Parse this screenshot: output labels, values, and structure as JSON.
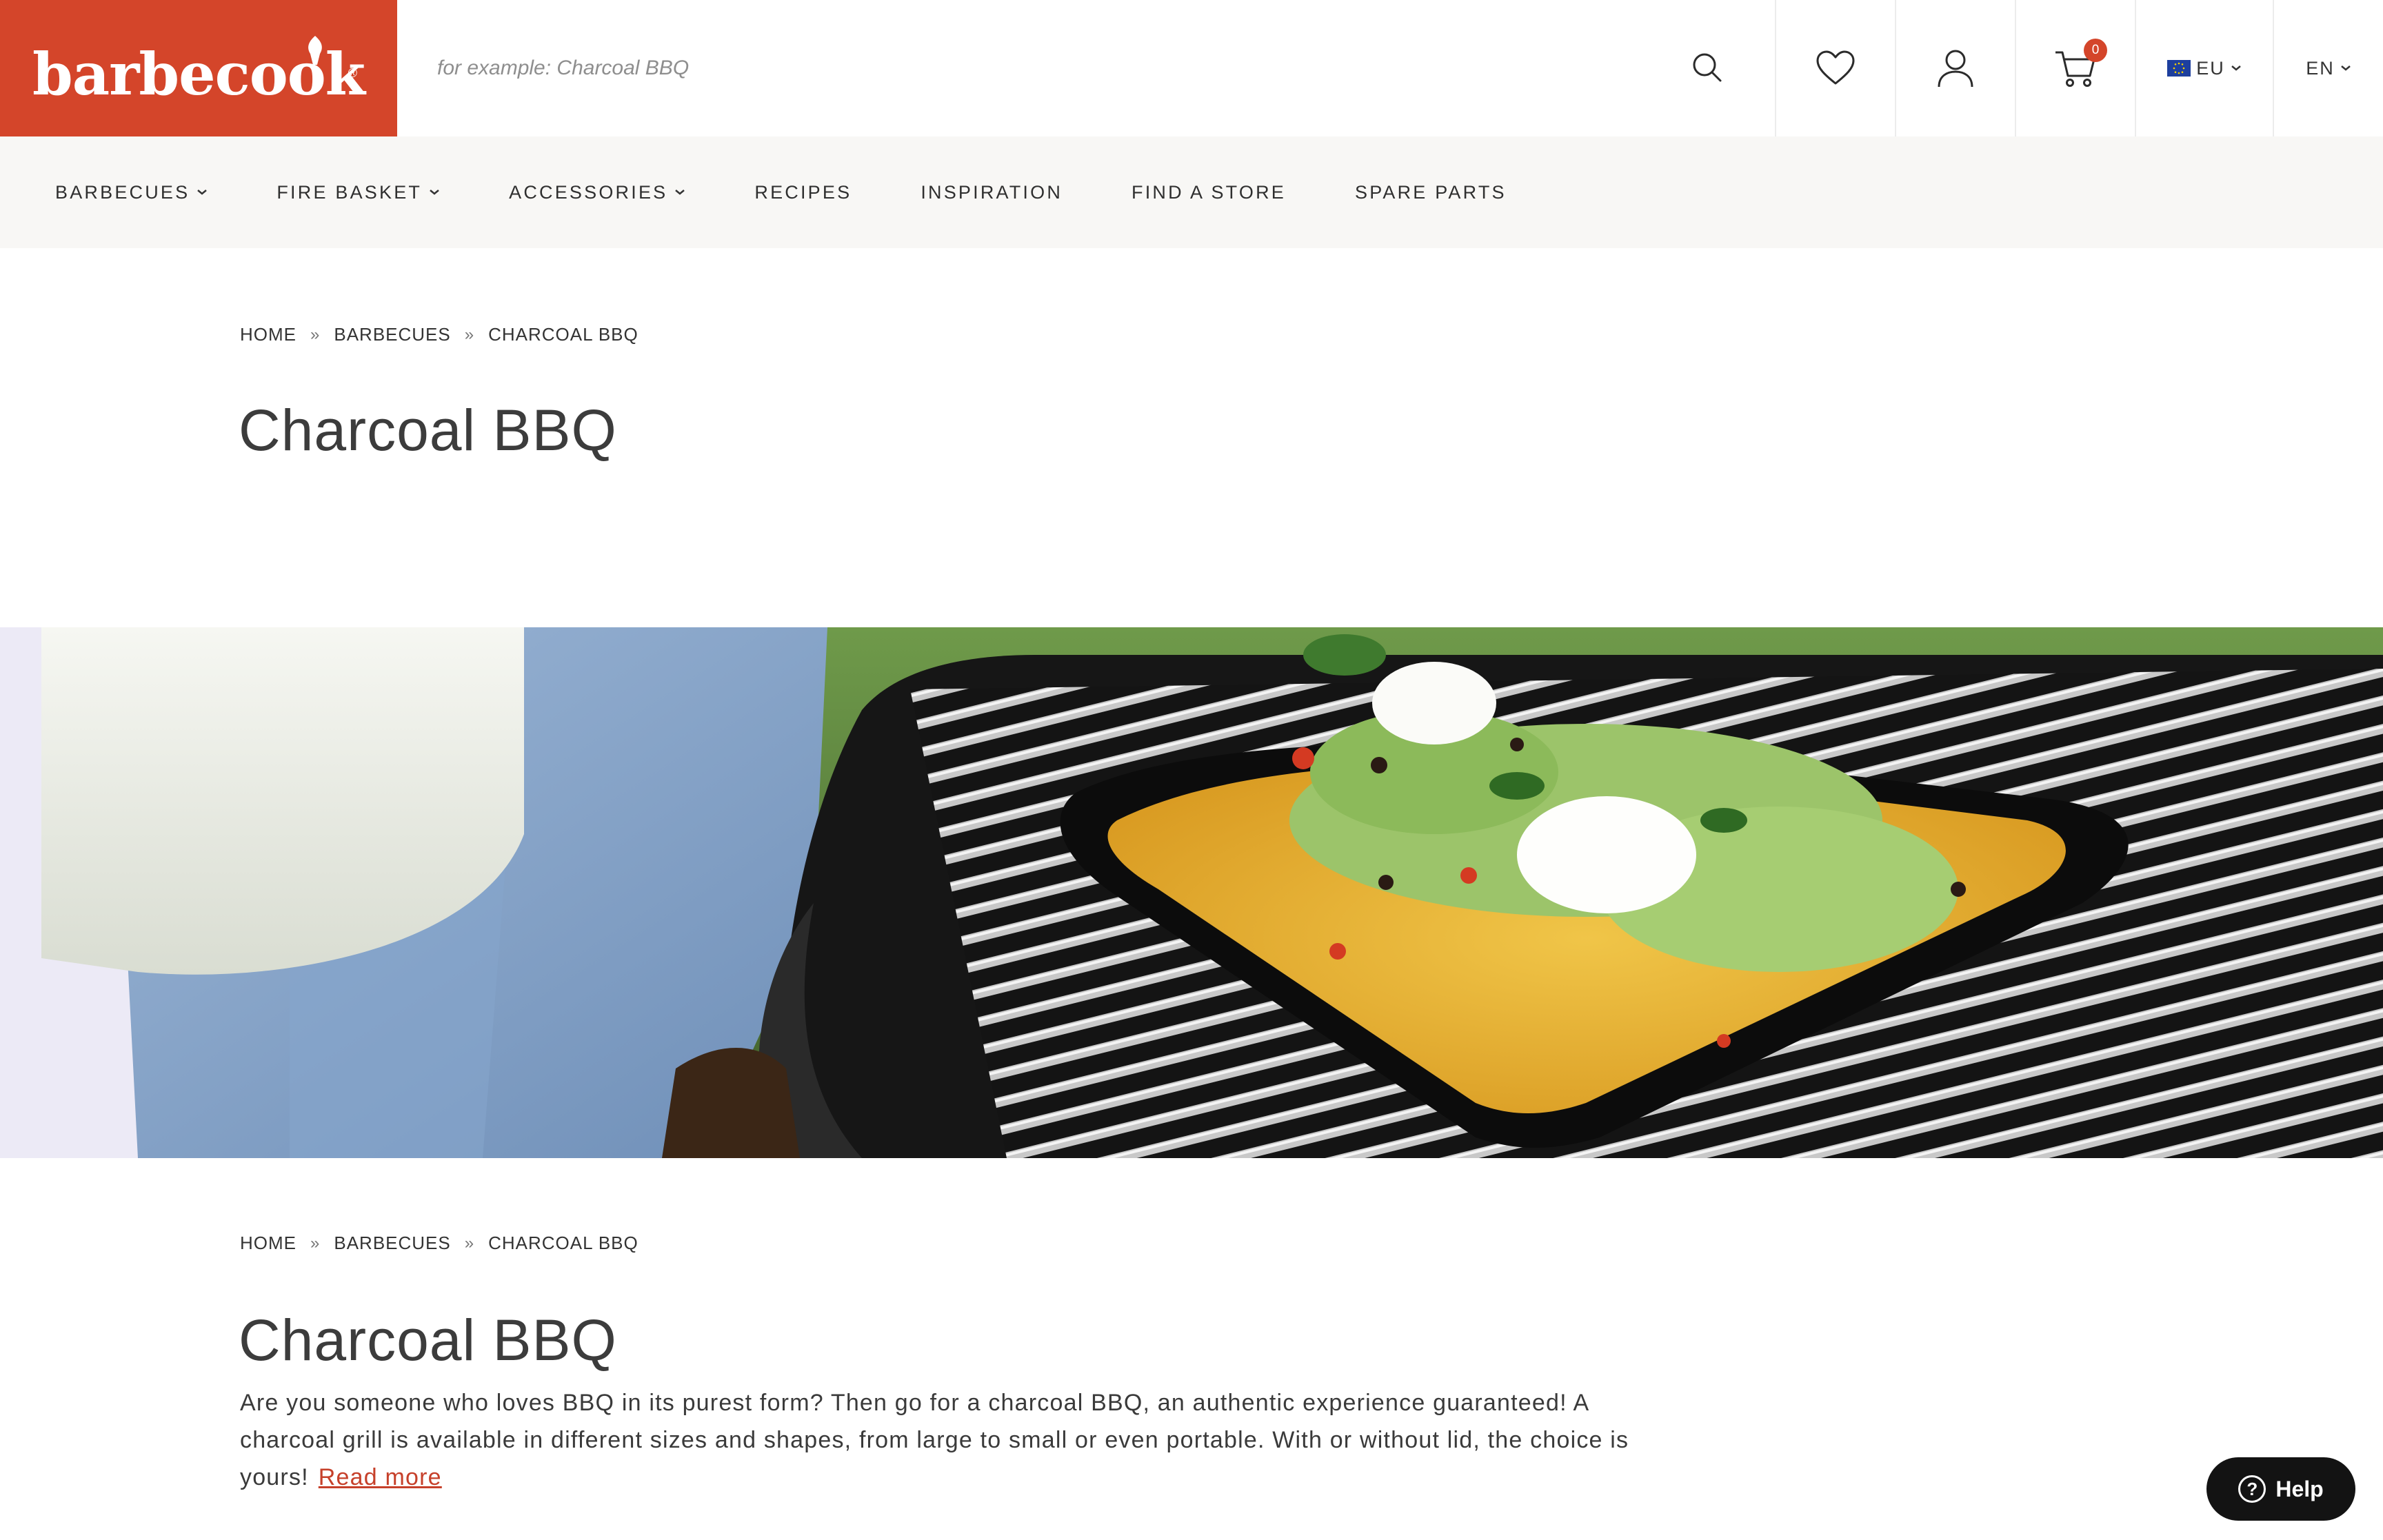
{
  "header": {
    "logo_text": "barbecook",
    "logo_reg": "®",
    "search_placeholder": "for example: Charcoal BBQ",
    "cart_count": "0",
    "region": "EU",
    "language": "EN",
    "brand_color": "#d4452a"
  },
  "nav": {
    "items": [
      {
        "label": "BARBECUES",
        "dropdown": true
      },
      {
        "label": "FIRE BASKET",
        "dropdown": true
      },
      {
        "label": "ACCESSORIES",
        "dropdown": true
      },
      {
        "label": "RECIPES",
        "dropdown": false
      },
      {
        "label": "INSPIRATION",
        "dropdown": false
      },
      {
        "label": "FIND A STORE",
        "dropdown": false
      },
      {
        "label": "SPARE PARTS",
        "dropdown": false
      }
    ]
  },
  "breadcrumb": {
    "home": "HOME",
    "level2": "BARBECUES",
    "current": "CHARCOAL BBQ",
    "separator": "»"
  },
  "page": {
    "title": "Charcoal BBQ",
    "description": "Are you someone who loves BBQ in its purest form? Then go for a charcoal BBQ, an authentic experience guaranteed! A charcoal grill is available in different sizes and shapes, from large to small or even portable. With or without lid, the choice is yours!",
    "read_more": "Read more"
  },
  "help": {
    "label": "Help",
    "icon_glyph": "?"
  },
  "icons": {
    "search": "search-icon",
    "wishlist": "heart-icon",
    "account": "user-icon",
    "cart": "cart-icon",
    "region_flag": "eu-flag-icon",
    "help": "question-icon"
  }
}
